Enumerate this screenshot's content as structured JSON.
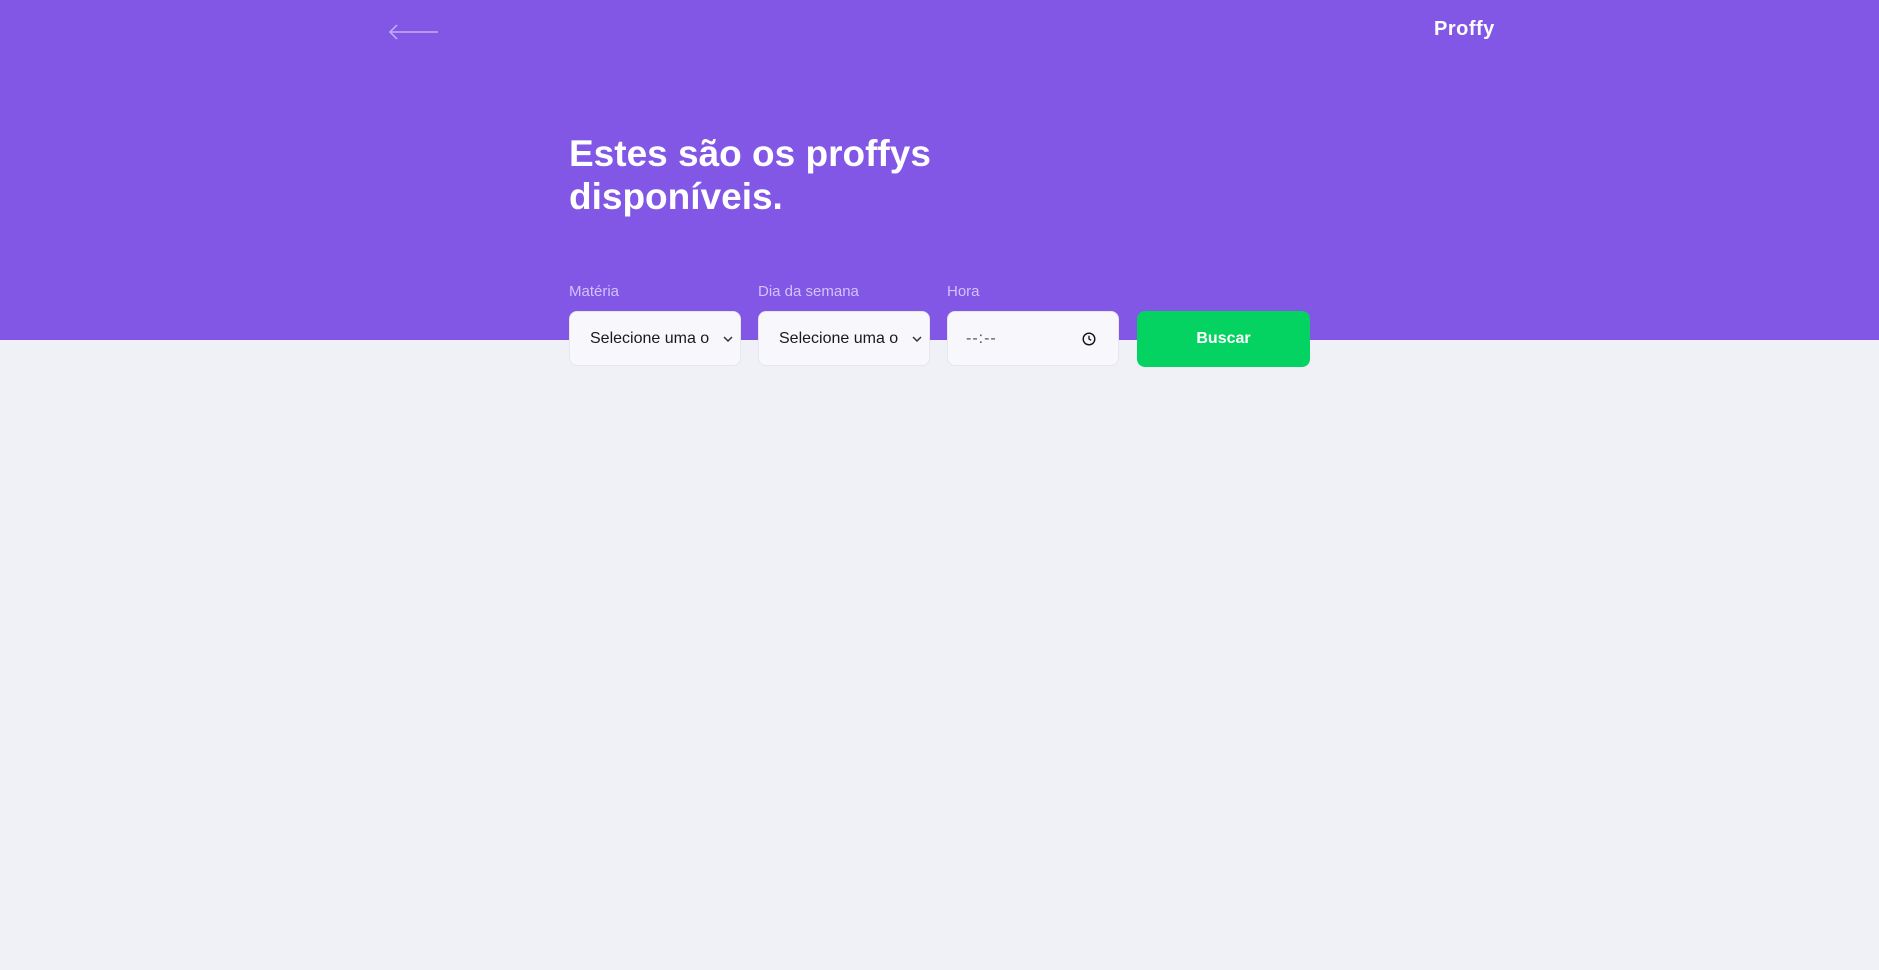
{
  "header": {
    "back_icon": "arrow-left-icon",
    "logo_text": "Proffy",
    "title_line1": "Estes são os proffys",
    "title_line2": "disponíveis.",
    "background_color": "#8257E5"
  },
  "filters": {
    "subject": {
      "label": "Matéria",
      "value": "Selecione uma op"
    },
    "week_day": {
      "label": "Dia da semana",
      "value": "Selecione uma op"
    },
    "time": {
      "label": "Hora",
      "value": "--:--",
      "icon": "clock-icon"
    },
    "submit_label": "Buscar",
    "submit_color": "#04D361"
  }
}
